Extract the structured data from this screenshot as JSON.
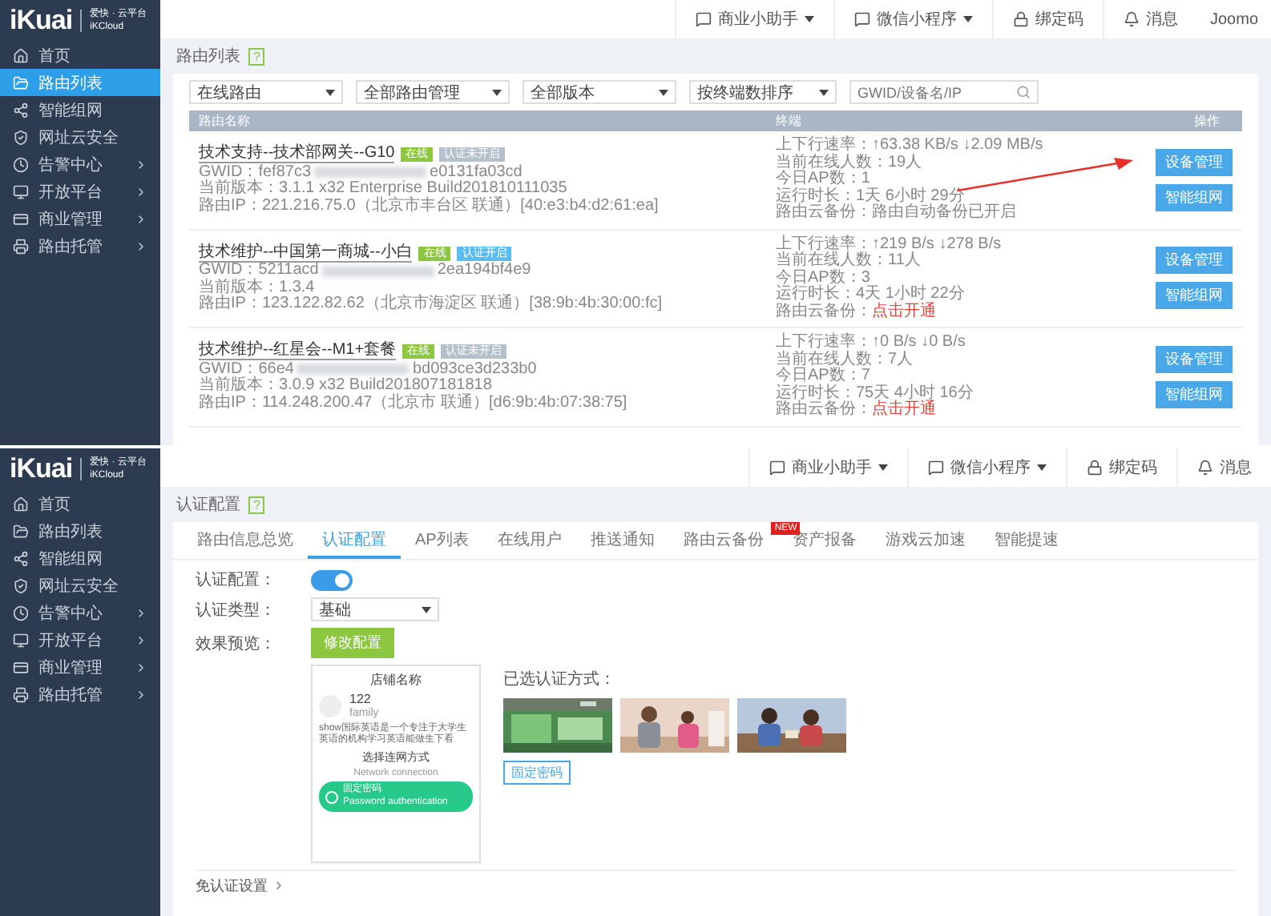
{
  "top_screen": {
    "logo": {
      "brand": "iKuai",
      "tagline": "爱快 · 云平台",
      "subtitle": "iKCloud"
    },
    "sidebar": {
      "items": [
        {
          "label": "首页",
          "selected": false,
          "submenu": false
        },
        {
          "label": "路由列表",
          "selected": true,
          "submenu": false
        },
        {
          "label": "智能组网",
          "selected": false,
          "submenu": false
        },
        {
          "label": "网址云安全",
          "selected": false,
          "submenu": false
        },
        {
          "label": "告警中心",
          "selected": false,
          "submenu": true
        },
        {
          "label": "开放平台",
          "selected": false,
          "submenu": true
        },
        {
          "label": "商业管理",
          "selected": false,
          "submenu": true
        },
        {
          "label": "路由托管",
          "selected": false,
          "submenu": true
        }
      ]
    },
    "header": {
      "items": [
        {
          "label": "商业小助手",
          "dropdown": true
        },
        {
          "label": "微信小程序",
          "dropdown": true
        },
        {
          "label": "绑定码",
          "dropdown": false
        },
        {
          "label": "消息",
          "dropdown": false
        }
      ],
      "user": "Joomo"
    },
    "page_title": "路由列表",
    "help": "?",
    "filters": [
      {
        "kind": "select",
        "label": "在线路由"
      },
      {
        "kind": "select",
        "label": "全部路由管理"
      },
      {
        "kind": "select",
        "label": "全部版本"
      },
      {
        "kind": "select",
        "label": "按终端数排序"
      },
      {
        "kind": "search",
        "placeholder": "GWID/设备名/IP"
      }
    ],
    "table": {
      "columns": [
        "路由名称",
        "终端",
        "操作"
      ],
      "rows": [
        {
          "name": "技术支持--技术部网关--G10",
          "badges": [
            {
              "label": "在线",
              "color": "#8dc63f"
            },
            {
              "label": "认证未开启",
              "color": "#b4c0cc"
            }
          ],
          "gwid_start": "GWID：fef87c3",
          "gwid_end": "e0131fa03cd",
          "version": "当前版本：3.1.1 x32 Enterprise Build201810111035",
          "ip": "路由IP：221.216.75.0（北京市丰台区 联通）[40:e3:b4:d2:61:ea]",
          "rate": "上下行速率：↑63.38 KB/s  ↓2.09 MB/s",
          "online": "当前在线人数：19人",
          "ap": "今日AP数：1",
          "uptime": "运行时长：1天 6小时 29分",
          "backup": {
            "label": "路由云备份：",
            "value": "路由自动备份已开启",
            "kind": "status"
          },
          "buttons": [
            "设备管理",
            "智能组网"
          ],
          "pointed": true
        },
        {
          "name": "技术维护--中国第一商城--小白",
          "badges": [
            {
              "label": "在线",
              "color": "#8dc63f"
            },
            {
              "label": "认证开启",
              "color": "#5bbcf2"
            }
          ],
          "gwid_start": "GWID：5211acd",
          "gwid_end": "2ea194bf4e9",
          "version": "当前版本：1.3.4",
          "ip": "路由IP：123.122.82.62（北京市海淀区 联通）[38:9b:4b:30:00:fc]",
          "rate": "上下行速率：↑219 B/s  ↓278 B/s",
          "online": "当前在线人数：11人",
          "ap": "今日AP数：3",
          "uptime": "运行时长：4天 1小时 22分",
          "backup": {
            "label": "路由云备份：",
            "value": "点击开通",
            "kind": "link"
          },
          "buttons": [
            "设备管理",
            "智能组网"
          ],
          "pointed": false
        },
        {
          "name": "技术维护--红星会--M1+套餐",
          "badges": [
            {
              "label": "在线",
              "color": "#8dc63f"
            },
            {
              "label": "认证未开启",
              "color": "#b4c0cc"
            }
          ],
          "gwid_start": "GWID：66e4",
          "gwid_end": "bd093ce3d233b0",
          "version": "当前版本：3.0.9 x32 Build201807181818",
          "ip": "路由IP：114.248.200.47（北京市 联通）[d6:9b:4b:07:38:75]",
          "rate": "上下行速率：↑0 B/s  ↓0 B/s",
          "online": "当前在线人数：7人",
          "ap": "今日AP数：7",
          "uptime": "运行时长：75天 4小时 16分",
          "backup": {
            "label": "路由云备份：",
            "value": "点击开通",
            "kind": "link"
          },
          "buttons": [
            "设备管理",
            "智能组网"
          ],
          "pointed": false
        }
      ]
    }
  },
  "bottom_screen": {
    "logo": {
      "brand": "iKuai",
      "tagline": "爱快 · 云平台",
      "subtitle": "iKCloud"
    },
    "sidebar": {
      "items": [
        {
          "label": "首页",
          "selected": false,
          "submenu": false
        },
        {
          "label": "路由列表",
          "selected": false,
          "submenu": false
        },
        {
          "label": "智能组网",
          "selected": false,
          "submenu": false
        },
        {
          "label": "网址云安全",
          "selected": false,
          "submenu": false
        },
        {
          "label": "告警中心",
          "selected": false,
          "submenu": true
        },
        {
          "label": "开放平台",
          "selected": false,
          "submenu": true
        },
        {
          "label": "商业管理",
          "selected": false,
          "submenu": true
        },
        {
          "label": "路由托管",
          "selected": false,
          "submenu": true
        }
      ]
    },
    "header": {
      "items": [
        {
          "label": "商业小助手",
          "dropdown": true
        },
        {
          "label": "微信小程序",
          "dropdown": true
        },
        {
          "label": "绑定码",
          "dropdown": false
        },
        {
          "label": "消息",
          "dropdown": false
        }
      ]
    },
    "page_title": "认证配置",
    "help": "?",
    "tabs": [
      {
        "label": "路由信息总览",
        "selected": false
      },
      {
        "label": "认证配置",
        "selected": true
      },
      {
        "label": "AP列表",
        "selected": false
      },
      {
        "label": "在线用户",
        "selected": false
      },
      {
        "label": "推送通知",
        "selected": false
      },
      {
        "label": "路由云备份",
        "selected": false
      },
      {
        "label": "资产报备",
        "selected": false,
        "badge": "NEW"
      },
      {
        "label": "游戏云加速",
        "selected": false
      },
      {
        "label": "智能提速",
        "selected": false
      }
    ],
    "form": {
      "auth_label": "认证配置：",
      "auth_on": true,
      "type_label": "认证类型：",
      "type_value": "基础",
      "preview_label": "效果预览：",
      "edit_button": "修改配置"
    },
    "preview": {
      "shop_title": "店铺名称",
      "name": "122",
      "subtitle": "family",
      "description": "show国际英语是一个专注于大学生英语的机构学习英语能做生下看",
      "connect_title": "选择连网方式",
      "connect_subtitle": "Network connection",
      "option_title": "固定密码",
      "option_subtitle": "Password authentication"
    },
    "methods": {
      "label": "已选认证方式：",
      "button": "固定密码"
    },
    "footer": {
      "label": "免认证设置"
    }
  }
}
